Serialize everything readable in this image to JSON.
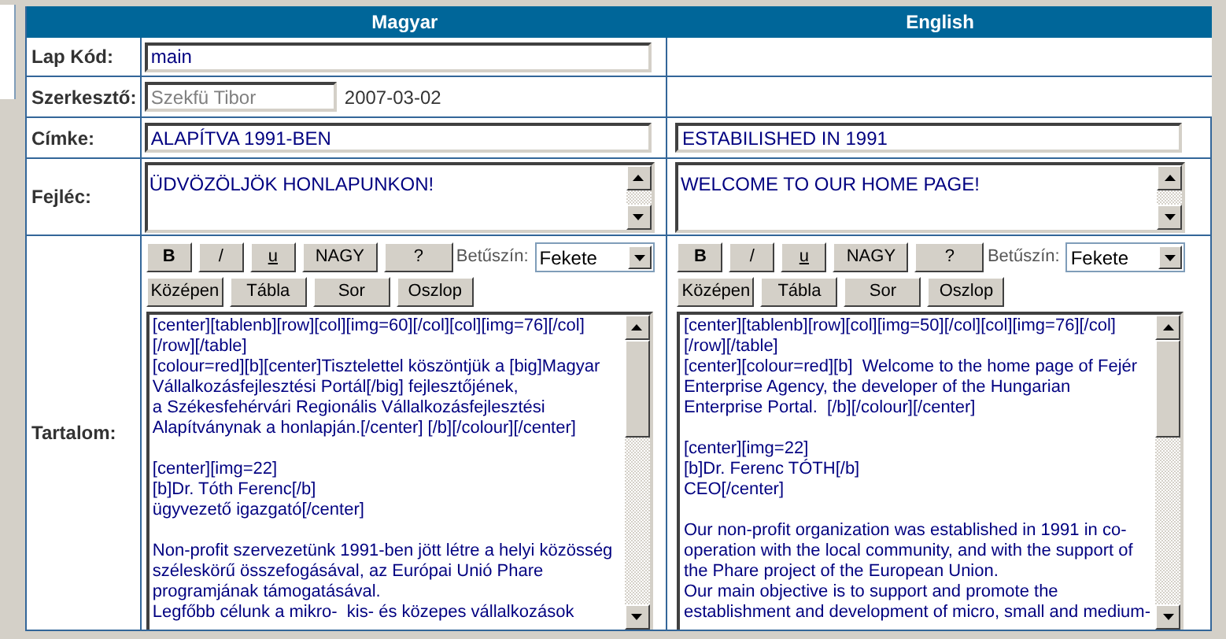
{
  "columns": [
    "Magyar",
    "English"
  ],
  "fields": [
    {
      "kind": "single",
      "label": "Lap Kód:",
      "value": "main"
    },
    {
      "kind": "author",
      "label": "Szerkesztő:",
      "value": "Szekfü Tibor",
      "disabled": true,
      "date": "2007-03-02"
    },
    {
      "kind": "pair",
      "label": "Címke:",
      "values": [
        "ALAPÍTVA 1991-BEN",
        "ESTABILISHED IN 1991"
      ]
    },
    {
      "kind": "memo",
      "label": "Fejléc:",
      "values": [
        "ÜDVÖZÖLJÖK HONLAPUNKON!",
        "WELCOME TO OUR HOME PAGE!"
      ]
    },
    {
      "kind": "content",
      "label": "Tartalom:",
      "editors": [
        {
          "buttons": [
            {
              "label": "B",
              "kind": "bold"
            },
            {
              "label": "/",
              "kind": "plain"
            },
            {
              "label": "u",
              "kind": "underline"
            },
            {
              "label": "NAGY",
              "kind": "plain"
            },
            {
              "label": "?",
              "kind": "plain"
            }
          ],
          "color_label": "Betűszín:",
          "color_value": "Fekete",
          "buttons2": [
            "Középen",
            "Tábla",
            "Sor",
            "Oszlop"
          ],
          "paragraphs": [
            [
              "[center][tablenb][row][col][img=60][/col][col][img=76][/col]",
              "[/row][/table]",
              "[colour=red][b][center]Tisztelettel köszöntjük a [big]Magyar",
              "Vállalkozásfejlesztési Portál[/big] fejlesztőjének,",
              "a Székesfehérvári Regionális Vállalkozásfejlesztési",
              "Alapítványnak a honlapján.[/center] [/b][/colour][/center]"
            ],
            [
              "[center][img=22]",
              "[b]Dr. Tóth Ferenc[/b]",
              "ügyvezető igazgató[/center]"
            ],
            [
              "Non-profit szervezetünk 1991-ben jött létre a helyi közösség",
              "széleskörű összefogásával, az Európai Unió Phare",
              "programjának támogatásával.",
              "Legfőbb célunk a mikro-  kis- és közepes vállalkozások"
            ]
          ]
        },
        {
          "buttons": [
            {
              "label": "B",
              "kind": "bold"
            },
            {
              "label": "/",
              "kind": "plain"
            },
            {
              "label": "u",
              "kind": "underline"
            },
            {
              "label": "NAGY",
              "kind": "plain"
            },
            {
              "label": "?",
              "kind": "plain"
            }
          ],
          "color_label": "Betűszín:",
          "color_value": "Fekete",
          "buttons2": [
            "Középen",
            "Tábla",
            "Sor",
            "Oszlop"
          ],
          "paragraphs": [
            [
              "[center][tablenb][row][col][img=50][/col][col][img=76][/col]",
              "[/row][/table]",
              "[center][colour=red][b]  Welcome to the home page of Fejér",
              "Enterprise Agency, the developer of the Hungarian",
              "Enterprise Portal.  [/b][/colour][/center]"
            ],
            [
              "[center][img=22]",
              "[b]Dr. Ferenc TÓTH[/b]",
              "CEO[/center]"
            ],
            [
              "Our non-profit organization was established in 1991 in co-",
              "operation with the local community, and with the support of",
              "the Phare project of the European Union.",
              "Our main objective is to support and promote the",
              "establishment and development of micro, small and medium-"
            ]
          ]
        }
      ]
    }
  ]
}
